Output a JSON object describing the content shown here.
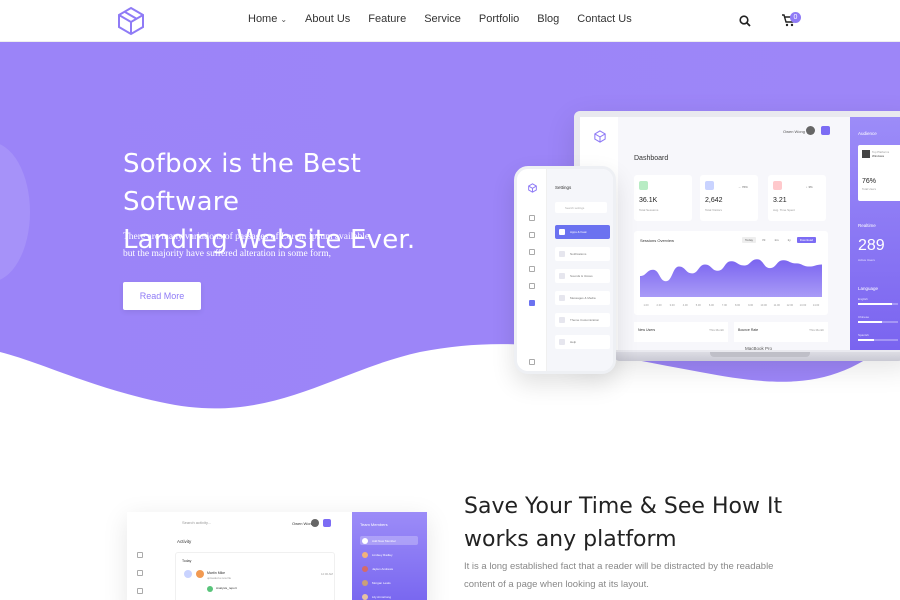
{
  "nav": {
    "items": [
      {
        "label": "Home",
        "has_dropdown": true
      },
      {
        "label": "About Us"
      },
      {
        "label": "Feature"
      },
      {
        "label": "Service"
      },
      {
        "label": "Portfolio"
      },
      {
        "label": "Blog"
      },
      {
        "label": "Contact Us"
      }
    ],
    "cart_count": "0",
    "accent": "#8f7bf6"
  },
  "hero": {
    "title_line1": "Sofbox is the Best Software",
    "title_line2": "Landing Website Ever.",
    "text_line1": "There are many variations of passages of Lorem Ipsum available,",
    "text_line2": "but the majority have suffered alteration in some form,",
    "button": "Read More",
    "bg_color": "#9b84f8"
  },
  "laptop": {
    "user": "Owen Wong",
    "title": "Dashboard",
    "stats": [
      {
        "value": "36.1K",
        "label": "Total Sessions",
        "pct": "↑ 5%",
        "color": "#b8ecc4"
      },
      {
        "value": "2,642",
        "label": "Total Visitors",
        "pct": "→ 76%",
        "color": "#c9d3ff"
      },
      {
        "value": "3.21",
        "label": "Avg. Time Spent",
        "pct": "↓ 3%",
        "color": "#ffc9cc"
      }
    ],
    "session_title": "Sessions Overview",
    "session_tabs": [
      "Today",
      "7d",
      "1m",
      "1y",
      "Download"
    ],
    "session_series": [
      40,
      52,
      30,
      58,
      45,
      62,
      50,
      68,
      60,
      72,
      55,
      70,
      64,
      58,
      62
    ],
    "session_x": [
      "1.00",
      "2.00",
      "3.00",
      "4.00",
      "5.00",
      "6.00",
      "7.00",
      "8.00",
      "9.00",
      "10.00",
      "11.00",
      "12.00",
      "13.00",
      "14.00"
    ],
    "bottom": [
      {
        "left": "New Users",
        "right": "This Month"
      },
      {
        "left": "Bounce Rate",
        "right": "This Month"
      }
    ],
    "right_panel": {
      "title": "Audience",
      "card_t1": "Top Platforms",
      "card_t2": "Windows",
      "card_value": "76%",
      "card_label": "Total Users",
      "realtime": "Realtime",
      "big_value": "289",
      "big_label": "Active Users",
      "language": "Language",
      "langs": [
        {
          "label": "English",
          "fill": 0.85
        },
        {
          "label": "Chinese",
          "fill": 0.6
        },
        {
          "label": "Spanish",
          "fill": 0.4
        }
      ]
    },
    "brand": "MacBook Pro"
  },
  "phone": {
    "title": "Settings",
    "search": "Search settings",
    "items": [
      {
        "label": "Apps & Feat",
        "active": true
      },
      {
        "label": "Notifications",
        "active": false
      },
      {
        "label": "Sounds & Voices",
        "active": false
      },
      {
        "label": "Messages & Media",
        "active": false
      },
      {
        "label": "Theme Customization",
        "active": false
      },
      {
        "label": "Help",
        "active": false
      }
    ]
  },
  "section2": {
    "title_line1": "Save Your Time & See How It",
    "title_line2": "works any platform",
    "text_line1": "It is a long established fact that a reader will be distracted by the readable",
    "text_line2": "content of a page when looking at its layout.",
    "mock": {
      "search": "Search activity...",
      "user": "Owen Wong",
      "activity": "Activity",
      "today": "Today",
      "name": "Martin Mike",
      "sub": "uploaded a new file",
      "time": "12:00 AM",
      "file": "Analysis_report",
      "team_title": "Team Members",
      "members": [
        "Add New Member",
        "Lindsey Radley",
        "Jaylen Andrews",
        "Morgan Lewis",
        "Lily Armstrong"
      ]
    }
  }
}
